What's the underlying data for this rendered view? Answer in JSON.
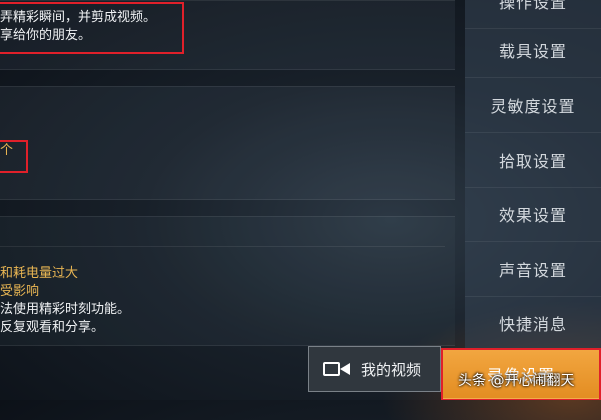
{
  "highlight": {
    "line1": "弄精彩瞬间，并剪成视频。",
    "line2": "享给你的朋友。"
  },
  "middle": {
    "count_suffix": "个"
  },
  "warning": {
    "line1": "和耗电量过大",
    "line2": "受影响",
    "line3": "法使用精彩时刻功能。",
    "line4": "反复观看和分享。"
  },
  "sidebar": {
    "items": [
      {
        "label": "操作设置"
      },
      {
        "label": "载具设置"
      },
      {
        "label": "灵敏度设置"
      },
      {
        "label": "拾取设置"
      },
      {
        "label": "效果设置"
      },
      {
        "label": "声音设置"
      },
      {
        "label": "快捷消息"
      },
      {
        "label": "录像设置"
      }
    ]
  },
  "video_button": {
    "label": "我的视频",
    "icon": "video-camera-icon"
  },
  "watermark": "头条 @开心闹翻天",
  "colors": {
    "accent": "#e38d22",
    "gold_text": "#e9b653",
    "highlight_border": "#e0202a"
  }
}
